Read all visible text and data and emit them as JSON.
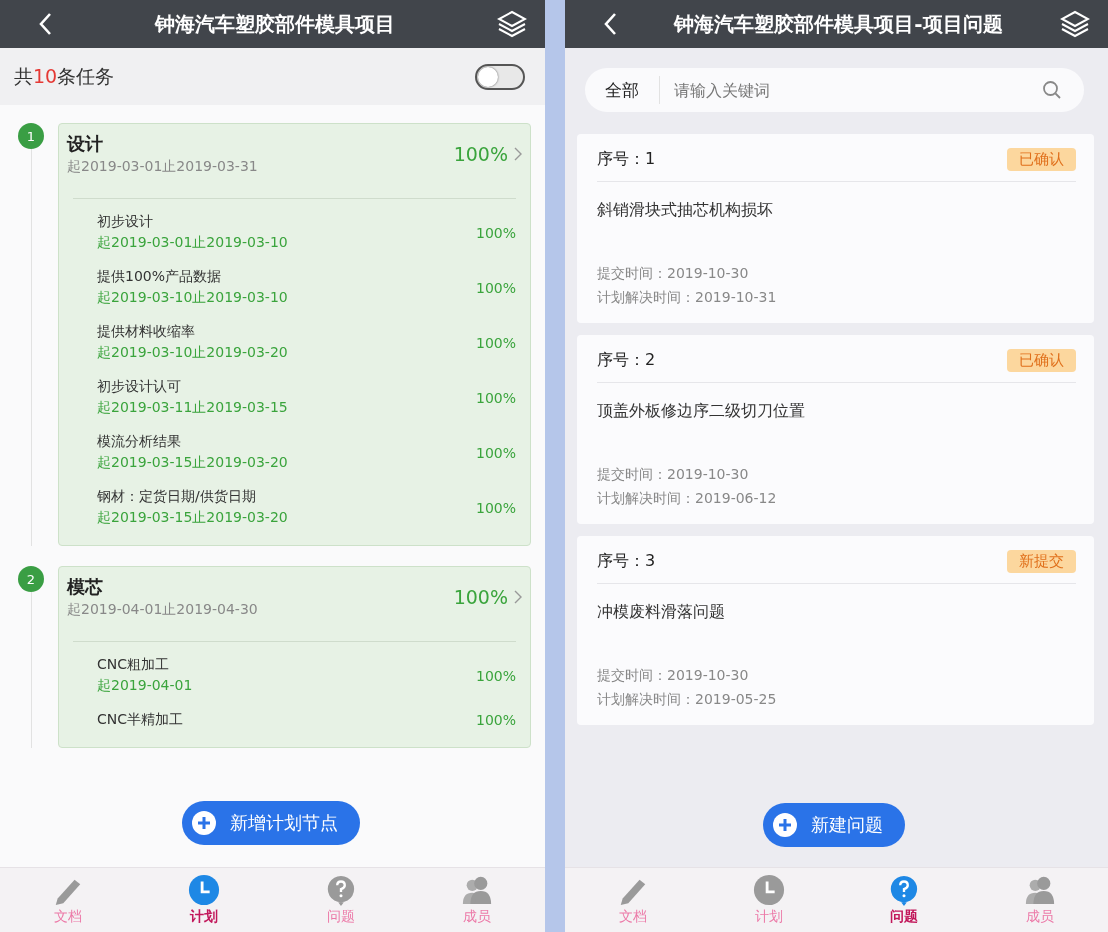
{
  "plan_screen": {
    "title": "钟海汽车塑胶部件模具项目",
    "task_count": {
      "prefix": "共",
      "count": "10",
      "suffix": "条任务"
    },
    "toggle": {
      "on": false
    },
    "stages": [
      {
        "number": "1",
        "name": "设计",
        "dates": "起2019-03-01止2019-03-31",
        "percent": "100%",
        "tasks": [
          {
            "name": "初步设计",
            "dates": "起2019-03-01止2019-03-10",
            "percent": "100%"
          },
          {
            "name": "提供100%产品数据",
            "dates": "起2019-03-10止2019-03-10",
            "percent": "100%"
          },
          {
            "name": "提供材料收缩率",
            "dates": "起2019-03-10止2019-03-20",
            "percent": "100%"
          },
          {
            "name": "初步设计认可",
            "dates": "起2019-03-11止2019-03-15",
            "percent": "100%"
          },
          {
            "name": "模流分析结果",
            "dates": "起2019-03-15止2019-03-20",
            "percent": "100%"
          },
          {
            "name": "钢材：定货日期/供货日期",
            "dates": "起2019-03-15止2019-03-20",
            "percent": "100%"
          }
        ]
      },
      {
        "number": "2",
        "name": "模芯",
        "dates": "起2019-04-01止2019-04-30",
        "percent": "100%",
        "tasks": [
          {
            "name": "CNC粗加工",
            "dates": "起2019-04-01",
            "percent": "100%"
          },
          {
            "name": "CNC半精加工",
            "percent": "100%"
          }
        ]
      }
    ],
    "fab": "新增计划节点",
    "tabs": [
      {
        "label": "文档",
        "selected": false
      },
      {
        "label": "计划",
        "selected": true
      },
      {
        "label": "问题",
        "selected": false
      },
      {
        "label": "成员",
        "selected": false
      }
    ]
  },
  "issues_screen": {
    "title": "钟海汽车塑胶部件模具项目-项目问题",
    "filter": "全部",
    "search": {
      "placeholder": "请输入关键词"
    },
    "issues": [
      {
        "number": "序号：1",
        "status": "已确认",
        "title": "斜销滑块式抽芯机构损坏",
        "submitted": "提交时间：2019-10-30",
        "planned": "计划解决时间：2019-10-31"
      },
      {
        "number": "序号：2",
        "status": "已确认",
        "title": "顶盖外板修边序二级切刀位置",
        "submitted": "提交时间：2019-10-30",
        "planned": "计划解决时间：2019-06-12"
      },
      {
        "number": "序号：3",
        "status": "新提交",
        "title": "冲模废料滑落问题",
        "submitted": "提交时间：2019-10-30",
        "planned": "计划解决时间：2019-05-25"
      }
    ],
    "fab": "新建问题",
    "tabs": [
      {
        "label": "文档",
        "selected": false
      },
      {
        "label": "计划",
        "selected": false
      },
      {
        "label": "问题",
        "selected": true
      },
      {
        "label": "成员",
        "selected": false
      }
    ]
  }
}
